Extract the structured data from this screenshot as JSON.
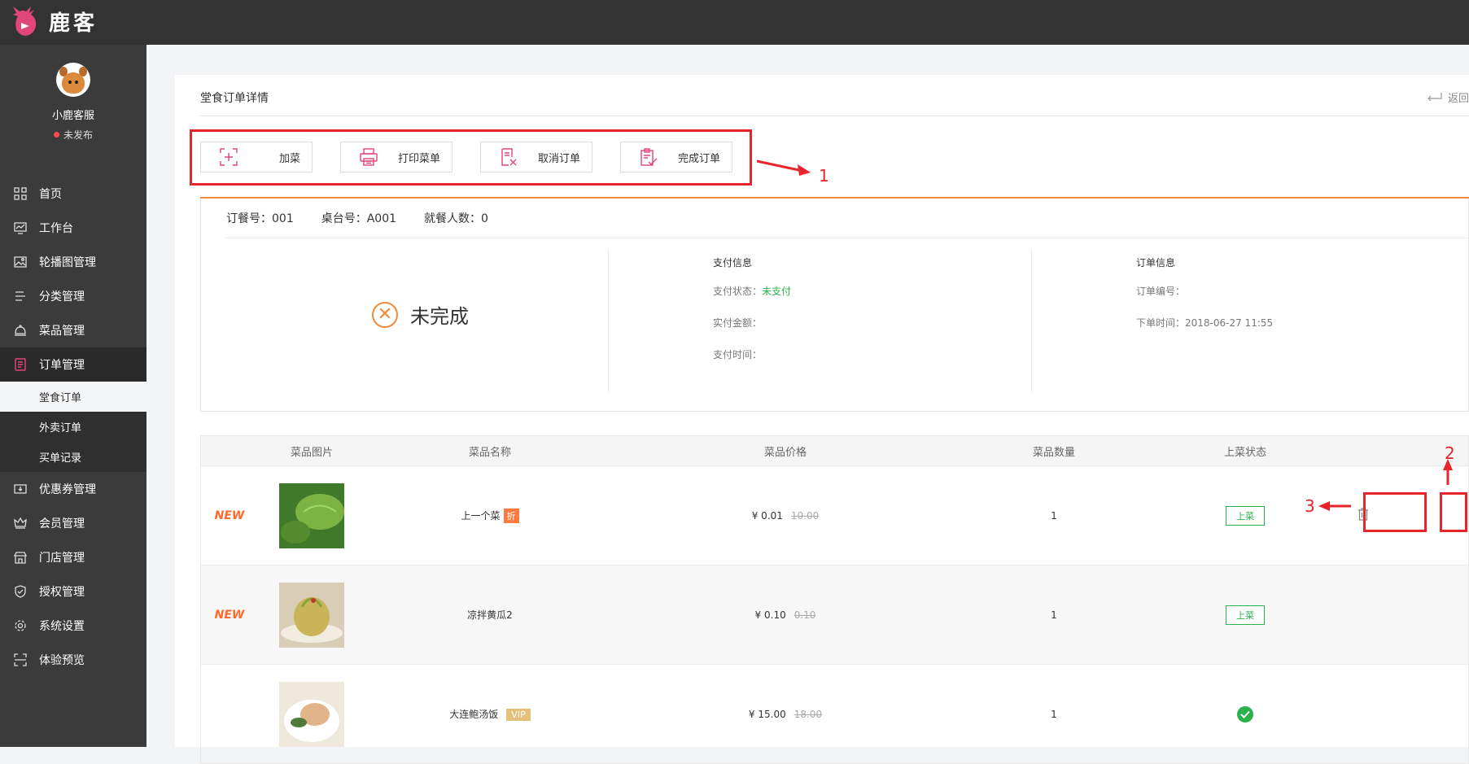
{
  "app": {
    "brand": "鹿客"
  },
  "profile": {
    "name": "小鹿客服",
    "status": "未发布"
  },
  "nav": {
    "home": "首页",
    "workbench": "工作台",
    "carousel": "轮播图管理",
    "category": "分类管理",
    "dishes": "菜品管理",
    "orders": "订单管理",
    "orders_dinein": "堂食订单",
    "orders_takeout": "外卖订单",
    "orders_purchase": "买单记录",
    "coupons": "优惠券管理",
    "members": "会员管理",
    "stores": "门店管理",
    "auth": "授权管理",
    "settings": "系统设置",
    "preview": "体验预览"
  },
  "page": {
    "title": "堂食订单详情",
    "back": "返回"
  },
  "actions": {
    "add_dish": "加菜",
    "print_menu": "打印菜单",
    "cancel_order": "取消订单",
    "complete_order": "完成订单"
  },
  "order": {
    "meal_no": "订餐号：001",
    "table_no": "桌台号：A001",
    "diners": "就餐人数：0",
    "status": "未完成"
  },
  "payment": {
    "title": "支付信息",
    "status_label": "支付状态：",
    "status_value": "未支付",
    "amount_label": "实付金额：",
    "time_label": "支付时间："
  },
  "order_info": {
    "title": "订单信息",
    "number_label": "订单编号：",
    "time": "下单时间：2018-06-27 11:55"
  },
  "table": {
    "headers": {
      "image": "菜品图片",
      "name": "菜品名称",
      "price": "菜品价格",
      "qty": "菜品数量",
      "serve": "上菜状态"
    },
    "rows": [
      {
        "flag": "NEW",
        "name": "上一个菜",
        "tag": "折",
        "price": "¥ 0.01",
        "old_price": "10.00",
        "qty": "1",
        "serve": "上菜"
      },
      {
        "flag": "NEW",
        "name": "凉拌黄瓜2",
        "tag": "",
        "price": "¥ 0.10",
        "old_price": "0.10",
        "qty": "1",
        "serve": "上菜"
      },
      {
        "flag": "",
        "name": "大连鲍汤饭",
        "tag": "VIP",
        "price": "¥ 15.00",
        "old_price": "18.00",
        "qty": "1",
        "serve": "done"
      }
    ]
  },
  "annotations": {
    "a1": "1",
    "a2": "2",
    "a3": "3"
  },
  "colors": {
    "accent": "#f08a3c",
    "brand": "#e0457b",
    "success": "#2bb24c",
    "annotation": "#e8232a"
  }
}
